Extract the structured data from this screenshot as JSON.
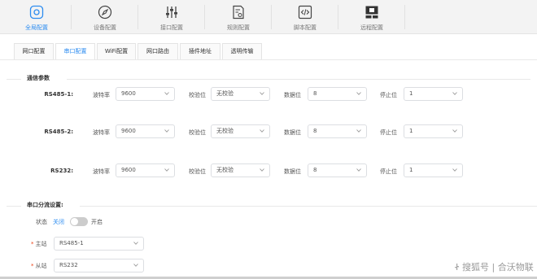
{
  "nav": {
    "items": [
      {
        "label": "全局配置",
        "icon": "gear-icon",
        "active": true
      },
      {
        "label": "设备配置",
        "icon": "compass-icon"
      },
      {
        "label": "接口配置",
        "icon": "sliders-icon"
      },
      {
        "label": "规则配置",
        "icon": "doc-settings-icon"
      },
      {
        "label": "脚本配置",
        "icon": "code-icon"
      },
      {
        "label": "远程配置",
        "icon": "remote-monitor-icon"
      }
    ]
  },
  "tabs": [
    {
      "label": "网口配置"
    },
    {
      "label": "串口配置",
      "active": true
    },
    {
      "label": "WiFi配置"
    },
    {
      "label": "网口路由"
    },
    {
      "label": "插件地址"
    },
    {
      "label": "透明传输"
    }
  ],
  "comm": {
    "title": "通信参数",
    "field_labels": {
      "baud": "波特率",
      "parity": "校验位",
      "databits": "数据位",
      "stopbits": "停止位"
    },
    "rows": [
      {
        "name": "RS485-1:",
        "baud": "9600",
        "parity": "无校验",
        "databits": "8",
        "stopbits": "1"
      },
      {
        "name": "RS485-2:",
        "baud": "9600",
        "parity": "无校验",
        "databits": "8",
        "stopbits": "1"
      },
      {
        "name": "RS232:",
        "baud": "9600",
        "parity": "无校验",
        "databits": "8",
        "stopbits": "1"
      }
    ]
  },
  "split": {
    "title": "串口分流设置:",
    "status_label": "状态",
    "off_label": "关闭",
    "on_label": "开启",
    "toggle_on": false,
    "master_label": "主站",
    "master_value": "RS485-1",
    "slave_label": "从站",
    "slave_value": "RS232",
    "required_mark": "*"
  },
  "watermark": "Ꮠ 搜狐号 | 合沃物联",
  "colors": {
    "accent": "#2d8cf0",
    "required": "#ed4014"
  }
}
